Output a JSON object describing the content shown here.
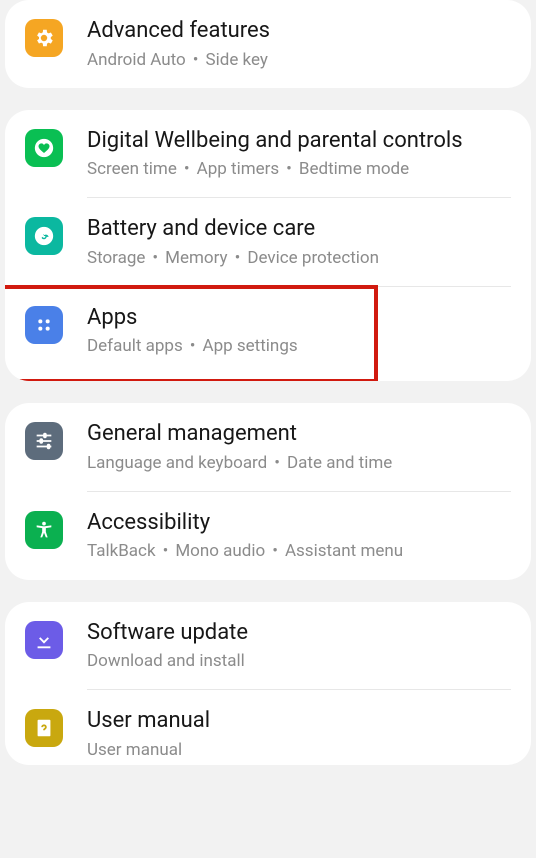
{
  "icon_colors": {
    "advanced": "#f5a623",
    "wellbeing": "#0abf53",
    "battery": "#0bb8a0",
    "apps": "#4a80e8",
    "general": "#5d6c7c",
    "accessibility": "#0bb050",
    "software": "#6c5ce7",
    "manual": "#c9a80f"
  },
  "bullet": "•",
  "rows": {
    "advanced": {
      "title": "Advanced features",
      "sub_parts": [
        "Android Auto",
        "Side key"
      ]
    },
    "wellbeing": {
      "title": "Digital Wellbeing and parental controls",
      "sub_parts": [
        "Screen time",
        "App timers",
        "Bedtime mode"
      ]
    },
    "battery": {
      "title": "Battery and device care",
      "sub_parts": [
        "Storage",
        "Memory",
        "Device protection"
      ]
    },
    "apps": {
      "title": "Apps",
      "sub_parts": [
        "Default apps",
        "App settings"
      ]
    },
    "general": {
      "title": "General management",
      "sub_parts": [
        "Language and keyboard",
        "Date and time"
      ]
    },
    "accessibility": {
      "title": "Accessibility",
      "sub_parts": [
        "TalkBack",
        "Mono audio",
        "Assistant menu"
      ]
    },
    "software": {
      "title": "Software update",
      "sub_parts": [
        "Download and install"
      ]
    },
    "manual": {
      "title": "User manual",
      "sub_parts": [
        "User manual"
      ]
    }
  }
}
